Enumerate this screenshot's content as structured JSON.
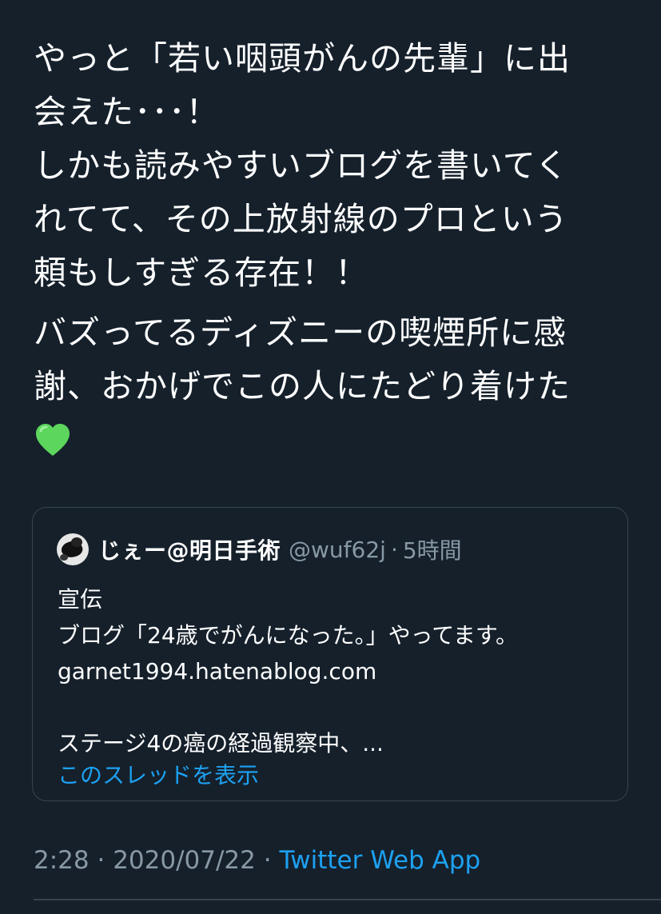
{
  "tweet": {
    "paragraph1": [
      "やっと「若い咽頭がんの先輩」に出",
      "会えた･･･！",
      "しかも読みやすいブログを書いてく",
      "れてて、その上放射線のプロという",
      "頼もしすぎる存在！！"
    ],
    "paragraph2": [
      "バズってるディズニーの喫煙所に感",
      "謝、おかげでこの人にたどり着けた"
    ],
    "heart_icon": "green-heart-icon",
    "heart_color": "#5cd65c"
  },
  "quoted_tweet": {
    "display_name": "じぇー@明日手術",
    "handle": "@wuf62j",
    "separator": "·",
    "time_ago": "5時間",
    "lines": [
      "宣伝",
      "ブログ「24歳でがんになった。」やってます。",
      "garnet1994.hatenablog.com",
      "",
      "ステージ4の癌の経過観察中、..."
    ],
    "show_thread_label": "このスレッドを表示"
  },
  "meta": {
    "time": "2:28",
    "separator": "·",
    "date": "2020/07/22",
    "app": "Twitter Web App"
  },
  "colors": {
    "background": "#15202b",
    "secondary_text": "#8899a6",
    "link": "#1da1f2",
    "border": "#38444d"
  }
}
